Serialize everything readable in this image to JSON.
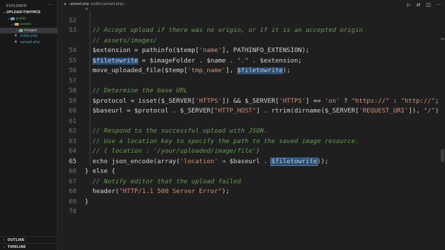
{
  "sidebar": {
    "title": "EXPLORER",
    "more": "···",
    "tree": [
      {
        "label": "UPLOAD-TINYMCE",
        "kind": "root",
        "chev": "⌄"
      },
      {
        "label": "public",
        "kind": "folder-public",
        "chev": "⌄"
      },
      {
        "label": "assets",
        "kind": "folder-assets",
        "chev": "⌄"
      },
      {
        "label": "images",
        "kind": "folder-images",
        "chev": "›"
      },
      {
        "label": "index.php",
        "kind": "file"
      },
      {
        "label": "upload.php",
        "kind": "file"
      }
    ],
    "outline_label": "OUTLINE",
    "timeline_label": "TIMELINE",
    "panel_chev": "›"
  },
  "topbar": {
    "file_icon": "php",
    "file_name": "upload.php",
    "path": "public/upload.php/...",
    "icons": [
      "▷",
      "⇄",
      "◫",
      "···"
    ]
  },
  "editor": {
    "active_line": 65,
    "lines": [
      {
        "n": "",
        "segments": [
          {
            "t": "*",
            "c": "c-comment"
          }
        ]
      },
      {
        "n": "52",
        "segments": []
      },
      {
        "n": "53",
        "segments": [
          {
            "t": "  // Accept upload if there was no origin, or if it is an accepted origin",
            "c": "c-comment"
          }
        ]
      },
      {
        "n": "",
        "segments": [
          {
            "t": "  // assets/images/",
            "c": "c-comment"
          }
        ]
      },
      {
        "n": "54",
        "segments": [
          {
            "t": "  $extension = pathinfo($temp[",
            "c": "c-var"
          },
          {
            "t": "'name'",
            "c": "c-str"
          },
          {
            "t": "], PATHINFO_EXTENSION);",
            "c": "c-var"
          }
        ]
      },
      {
        "n": "55",
        "segments": [
          {
            "t": "  ",
            "c": "c-var"
          },
          {
            "t": "$filetowrite",
            "c": "hl"
          },
          {
            "t": " = $imageFolder . $name . ",
            "c": "c-var"
          },
          {
            "t": "\".\"",
            "c": "c-str"
          },
          {
            "t": " . $extension;",
            "c": "c-var"
          }
        ]
      },
      {
        "n": "56",
        "segments": [
          {
            "t": "  move_uploaded_file($temp[",
            "c": "c-var"
          },
          {
            "t": "'tmp_name'",
            "c": "c-str"
          },
          {
            "t": "], ",
            "c": "c-var"
          },
          {
            "t": "$filetowrite",
            "c": "hl"
          },
          {
            "t": ");",
            "c": "c-var"
          }
        ]
      },
      {
        "n": "57",
        "segments": []
      },
      {
        "n": "58",
        "segments": [
          {
            "t": "  // Determine the base URL",
            "c": "c-comment"
          }
        ]
      },
      {
        "n": "59",
        "segments": [
          {
            "t": "  $protocol = isset($_SERVER[",
            "c": "c-var"
          },
          {
            "t": "'HTTPS'",
            "c": "c-str"
          },
          {
            "t": "]) && $_SERVER[",
            "c": "c-var"
          },
          {
            "t": "'HTTPS'",
            "c": "c-str"
          },
          {
            "t": "] == ",
            "c": "c-var"
          },
          {
            "t": "'on'",
            "c": "c-str"
          },
          {
            "t": " ? ",
            "c": "c-var"
          },
          {
            "t": "\"https://\"",
            "c": "c-str"
          },
          {
            "t": " : ",
            "c": "c-var"
          },
          {
            "t": "\"http://\"",
            "c": "c-str"
          },
          {
            "t": ";",
            "c": "c-var"
          }
        ]
      },
      {
        "n": "60",
        "segments": [
          {
            "t": "  $baseurl = $protocol . $_SERVER[",
            "c": "c-var"
          },
          {
            "t": "\"HTTP_HOST\"",
            "c": "c-str"
          },
          {
            "t": "] . rtrim(dirname($_SERVER[",
            "c": "c-var"
          },
          {
            "t": "'REQUEST_URI'",
            "c": "c-str"
          },
          {
            "t": "]), ",
            "c": "c-var"
          },
          {
            "t": "\"/\"",
            "c": "c-str"
          },
          {
            "t": ") . ",
            "c": "c-var"
          },
          {
            "t": "\"/\"",
            "c": "c-str"
          },
          {
            "t": ";",
            "c": "c-var"
          }
        ]
      },
      {
        "n": "61",
        "segments": []
      },
      {
        "n": "62",
        "segments": [
          {
            "t": "  // Respond to the successful upload with JSON.",
            "c": "c-comment"
          }
        ]
      },
      {
        "n": "63",
        "segments": [
          {
            "t": "  // Use a location key to specify the path to the saved image resource.",
            "c": "c-comment"
          }
        ]
      },
      {
        "n": "64",
        "segments": [
          {
            "t": "  // { location : '/your/uploaded/image/file'}",
            "c": "c-comment"
          }
        ]
      },
      {
        "n": "65",
        "segments": [
          {
            "t": "  echo json_encode(array(",
            "c": "c-var"
          },
          {
            "t": "'location'",
            "c": "c-str"
          },
          {
            "t": " ⇒ $baseurl . ",
            "c": "c-var"
          },
          {
            "t": "$filetowrite",
            "c": "hl-border"
          },
          {
            "t": "));",
            "c": "c-var"
          }
        ]
      },
      {
        "n": "66",
        "segments": [
          {
            "t": "} else {",
            "c": "c-var"
          }
        ]
      },
      {
        "n": "67",
        "segments": [
          {
            "t": "  // Notify editor that the upload failed",
            "c": "c-comment"
          }
        ]
      },
      {
        "n": "68",
        "segments": [
          {
            "t": "  header(",
            "c": "c-var"
          },
          {
            "t": "\"HTTP/1.1 500 Server Error\"",
            "c": "c-str"
          },
          {
            "t": ");",
            "c": "c-var"
          }
        ]
      },
      {
        "n": "69",
        "segments": [
          {
            "t": "}",
            "c": "c-var"
          }
        ]
      },
      {
        "n": "70",
        "segments": []
      }
    ]
  }
}
